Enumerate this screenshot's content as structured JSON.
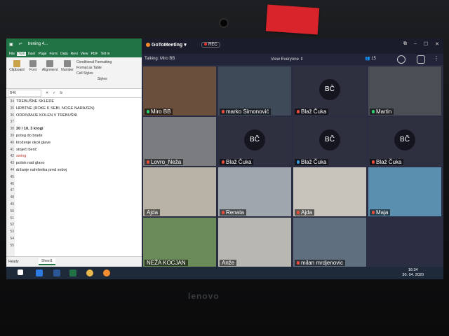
{
  "excel": {
    "title": "trening 4...",
    "menu": [
      "File",
      "Hom",
      "Inser",
      "Page",
      "Form",
      "Data",
      "Revi",
      "View",
      "PDF",
      "Tell m"
    ],
    "active_tab": "Hom",
    "ribbon": {
      "clipboard": "Clipboard",
      "font": "Font",
      "alignment": "Alignment",
      "number": "Number",
      "cond_format": "Conditional Formatting",
      "format_table": "Format as Table",
      "cell_styles": "Cell Styles",
      "styles": "Styles"
    },
    "name_box": "B46",
    "rows": [
      {
        "n": "34",
        "text": "TREBUŠNE SKLEDE",
        "style": ""
      },
      {
        "n": "35",
        "text": "HRBTNE (ROKE K SEBI, NOGE NARAZEN)",
        "style": ""
      },
      {
        "n": "36",
        "text": "ODRIVANJE KOLEN V TREBUŠNI",
        "style": ""
      },
      {
        "n": "37",
        "text": "",
        "style": ""
      },
      {
        "n": "38",
        "text": "20 / 10, 3 krogi",
        "style": "bold"
      },
      {
        "n": "39",
        "text": "poteg do brade",
        "style": ""
      },
      {
        "n": "40",
        "text": "kroženje okoli glave",
        "style": ""
      },
      {
        "n": "41",
        "text": "stoječi benč",
        "style": ""
      },
      {
        "n": "42",
        "text": "swing",
        "style": "red"
      },
      {
        "n": "43",
        "text": "potisk nad glavo",
        "style": ""
      },
      {
        "n": "44",
        "text": "držanje nahrbnika pred seboj",
        "style": ""
      },
      {
        "n": "45",
        "text": "",
        "style": ""
      },
      {
        "n": "46",
        "text": "",
        "style": ""
      },
      {
        "n": "47",
        "text": "",
        "style": ""
      },
      {
        "n": "48",
        "text": "",
        "style": ""
      },
      {
        "n": "49",
        "text": "",
        "style": ""
      },
      {
        "n": "50",
        "text": "",
        "style": ""
      },
      {
        "n": "51",
        "text": "",
        "style": ""
      },
      {
        "n": "52",
        "text": "",
        "style": ""
      },
      {
        "n": "53",
        "text": "",
        "style": ""
      },
      {
        "n": "54",
        "text": "",
        "style": ""
      },
      {
        "n": "55",
        "text": "",
        "style": ""
      }
    ],
    "sheet_tab": "Sheet1",
    "status": "Ready"
  },
  "gtm": {
    "app_name": "GoToMeeting",
    "rec_label": "REC",
    "talking": "Talking: Miro BB",
    "view": "View Everyone",
    "participant_count": "15",
    "tiles": [
      {
        "name": "Miro BB",
        "mic": "green",
        "bg": "#6a4f3c",
        "initials": ""
      },
      {
        "name": "marko Simonović",
        "mic": "red",
        "bg": "#3f4a58",
        "initials": ""
      },
      {
        "name": "Blaž Čuka",
        "mic": "red",
        "bg": "#2e3040",
        "initials": "BČ"
      },
      {
        "name": "Martin",
        "mic": "green",
        "bg": "#4a4f55",
        "initials": ""
      },
      {
        "name": "Lovro_Neža",
        "mic": "red",
        "bg": "#7a7c80",
        "initials": ""
      },
      {
        "name": "Blaž Čuka",
        "mic": "red",
        "bg": "#2e3040",
        "initials": "BČ"
      },
      {
        "name": "Blaž Čuka",
        "mic": "blue",
        "bg": "#2e3040",
        "initials": "BČ"
      },
      {
        "name": "Blaž Čuka",
        "mic": "red",
        "bg": "#2e3040",
        "initials": "BČ"
      },
      {
        "name": "Ajda",
        "mic": "",
        "bg": "#b9b3a6",
        "initials": ""
      },
      {
        "name": "Renata",
        "mic": "red",
        "bg": "#9fa6ae",
        "initials": ""
      },
      {
        "name": "Ajda",
        "mic": "red",
        "bg": "#c8c4bc",
        "initials": ""
      },
      {
        "name": "Maja",
        "mic": "red",
        "bg": "#5b8fb0",
        "initials": ""
      },
      {
        "name": "NEŽA KOCJAN",
        "mic": "",
        "bg": "#6b8a5a",
        "initials": ""
      },
      {
        "name": "Anže",
        "mic": "",
        "bg": "#b8b7b2",
        "initials": ""
      },
      {
        "name": "milan mrdjenovic",
        "mic": "red",
        "bg": "#5f6f80",
        "initials": ""
      },
      {
        "name": "",
        "mic": "",
        "bg": "#2b2d42",
        "initials": ""
      }
    ]
  },
  "taskbar": {
    "time": "16:34",
    "date": "30. 04. 2020"
  },
  "laptop_brand": "lenovo",
  "colors": {
    "excel_green": "#217346",
    "gtm_bg": "#2b2d42",
    "accent_orange": "#f68d2e",
    "tape_red": "#d8242a"
  }
}
